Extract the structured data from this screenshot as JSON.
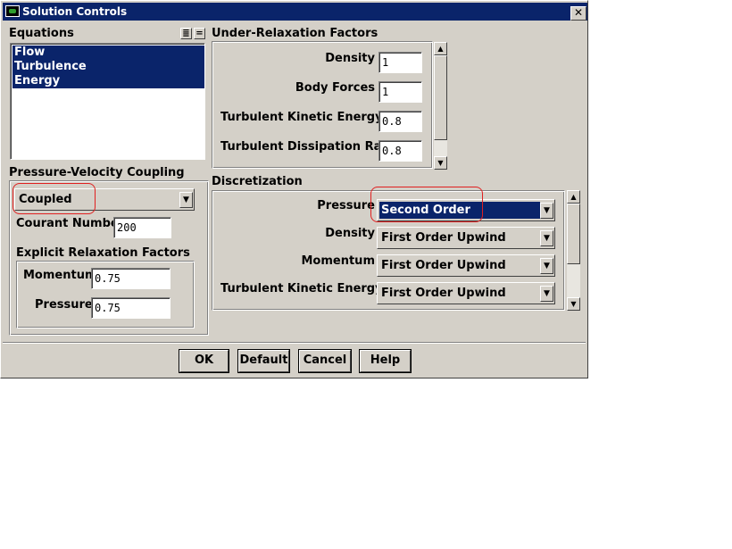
{
  "window": {
    "title": "Solution Controls",
    "close_glyph": "✕"
  },
  "equations": {
    "label": "Equations",
    "items": [
      "Flow",
      "Turbulence",
      "Energy"
    ],
    "select_all_glyph": "≣",
    "deselect_glyph": "="
  },
  "urf": {
    "label": "Under-Relaxation Factors",
    "rows": [
      {
        "label": "Density",
        "value": "1"
      },
      {
        "label": "Body Forces",
        "value": "1"
      },
      {
        "label": "Turbulent Kinetic Energy",
        "value": "0.8"
      },
      {
        "label": "Turbulent Dissipation Rate",
        "value": "0.8"
      }
    ]
  },
  "pvc": {
    "label": "Pressure-Velocity Coupling",
    "scheme": "Coupled",
    "courant_label": "Courant Number",
    "courant_value": "200",
    "explicit_label": "Explicit Relaxation Factors",
    "momentum_label": "Momentum",
    "momentum_value": "0.75",
    "pressure_label": "Pressure",
    "pressure_value": "0.75"
  },
  "disc": {
    "label": "Discretization",
    "rows": [
      {
        "label": "Pressure",
        "value": "Second Order"
      },
      {
        "label": "Density",
        "value": "First Order Upwind"
      },
      {
        "label": "Momentum",
        "value": "First Order Upwind"
      },
      {
        "label": "Turbulent Kinetic Energy",
        "value": "First Order Upwind"
      }
    ]
  },
  "buttons": {
    "ok": "OK",
    "default": "Default",
    "cancel": "Cancel",
    "help": "Help"
  },
  "glyphs": {
    "down": "▼",
    "up": "▲"
  },
  "colors": {
    "selection": "#0a246a",
    "annotation": "#e02020",
    "face": "#d4d0c8"
  }
}
